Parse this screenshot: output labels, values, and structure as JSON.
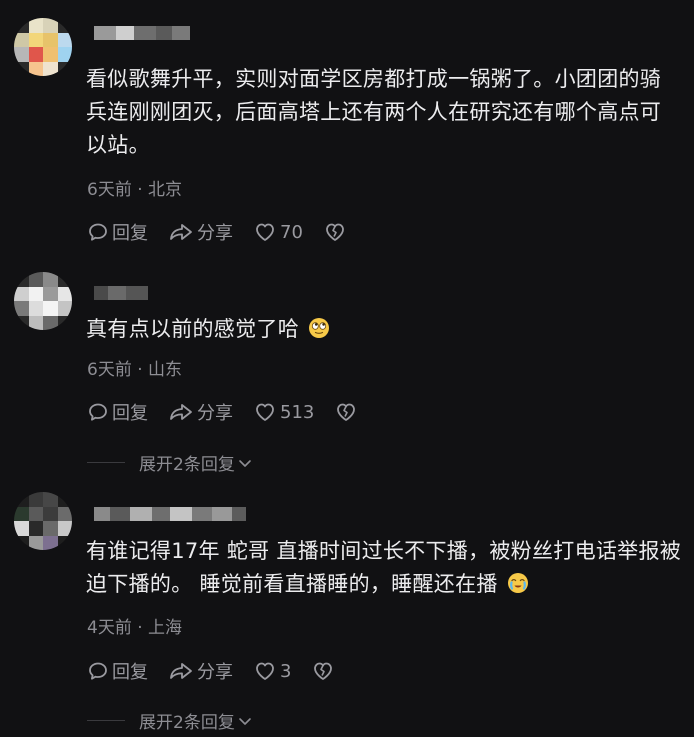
{
  "comments": [
    {
      "text": "看似歌舞升平，实则对面学区房都打成一锅粥了。小团团的骑兵连刚刚团灭，后面高塔上还有两个人在研究还有哪个高点可以站。",
      "time": "6天前",
      "location": "北京",
      "reply_label": "回复",
      "share_label": "分享",
      "likes": "70"
    },
    {
      "text": "真有点以前的感觉了哈",
      "emoji": "rolling-eyes-emoji",
      "time": "6天前",
      "location": "山东",
      "reply_label": "回复",
      "share_label": "分享",
      "likes": "513",
      "expand_label": "展开2条回复"
    },
    {
      "text": "有谁记得17年 蛇哥 直播时间过长不下播，被粉丝打电话举报被迫下播的。  睡觉前看直播睡的，睡醒还在播",
      "emoji": "crying-emoji",
      "time": "4天前",
      "location": "上海",
      "reply_label": "回复",
      "share_label": "分享",
      "likes": "3",
      "expand_label": "展开2条回复"
    }
  ],
  "separator": "·"
}
